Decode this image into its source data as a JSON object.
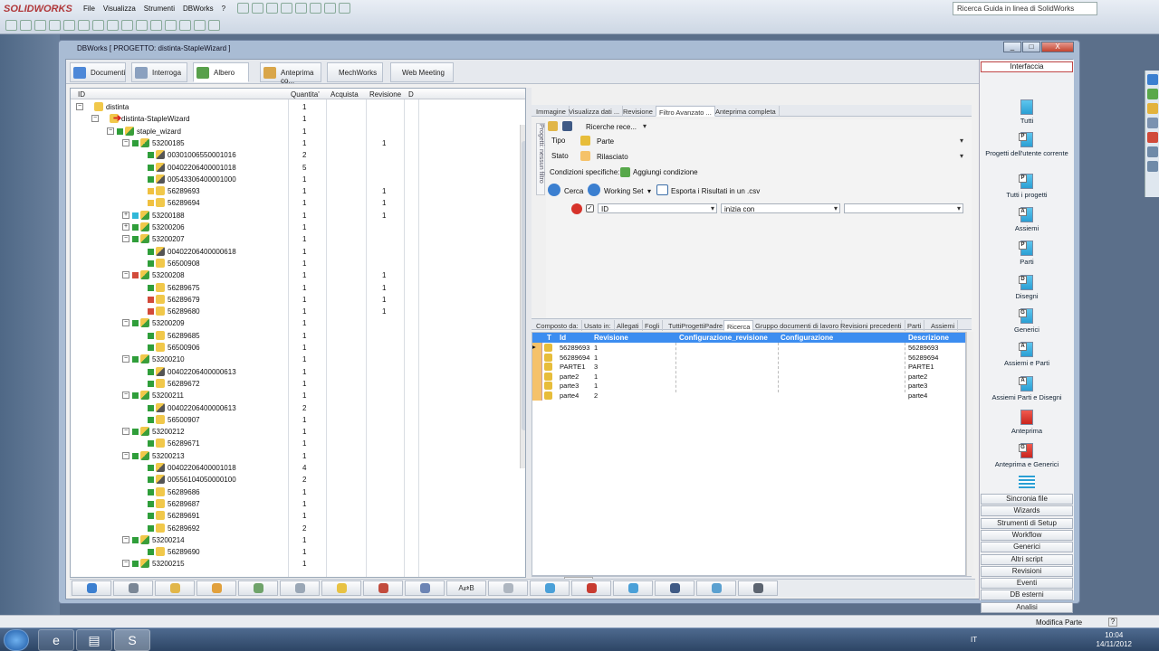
{
  "solidworks": {
    "logo": "SOLIDWORKS",
    "menu": [
      "File",
      "Visualizza",
      "Strumenti",
      "DBWorks",
      "?"
    ],
    "help_search": "Ricerca Guida in linea di SolidWorks"
  },
  "window": {
    "title": "DBWorks [ PROGETTO: distinta-StapleWizard ]",
    "minimize": "_",
    "maximize": "□",
    "close": "X"
  },
  "top_tabs": [
    "Documenti",
    "Interroga",
    "Albero",
    "Anteprima co...",
    "MechWorks",
    "Web Meeting"
  ],
  "tree": {
    "headers": {
      "id": "ID",
      "qty": "Quantita'",
      "buy": "Acquista",
      "rev": "Revisione",
      "d": "D"
    },
    "rows": [
      {
        "level": 0,
        "label": "distinta",
        "qty": "1",
        "rev": "",
        "icon": "assembly",
        "sq": "",
        "exp": "-"
      },
      {
        "level": 1,
        "label": "distinta-StapleWizard",
        "qty": "1",
        "rev": "",
        "icon": "assembly",
        "sq": "",
        "exp": "-"
      },
      {
        "level": 2,
        "label": "staple_wizard",
        "qty": "1",
        "rev": "",
        "icon": "assembly-green",
        "sq": "green",
        "exp": "-"
      },
      {
        "level": 3,
        "label": "53200185",
        "qty": "1",
        "rev": "1",
        "icon": "assembly-green",
        "sq": "green",
        "exp": "-"
      },
      {
        "level": 4,
        "label": "00301006550001016",
        "qty": "2",
        "rev": "",
        "icon": "part-tool",
        "sq": "green",
        "exp": ""
      },
      {
        "level": 4,
        "label": "00402206400001018",
        "qty": "5",
        "rev": "",
        "icon": "part-tool",
        "sq": "green",
        "exp": ""
      },
      {
        "level": 4,
        "label": "00543306400001000",
        "qty": "1",
        "rev": "",
        "icon": "part-tool",
        "sq": "green",
        "exp": ""
      },
      {
        "level": 4,
        "label": "56289693",
        "qty": "1",
        "rev": "1",
        "icon": "part",
        "sq": "yellow",
        "exp": ""
      },
      {
        "level": 4,
        "label": "56289694",
        "qty": "1",
        "rev": "1",
        "icon": "part",
        "sq": "yellow",
        "exp": ""
      },
      {
        "level": 3,
        "label": "53200188",
        "qty": "1",
        "rev": "1",
        "icon": "assembly-green",
        "sq": "cyan",
        "exp": "+"
      },
      {
        "level": 3,
        "label": "53200206",
        "qty": "1",
        "rev": "",
        "icon": "assembly-green",
        "sq": "green",
        "exp": "+"
      },
      {
        "level": 3,
        "label": "53200207",
        "qty": "1",
        "rev": "",
        "icon": "assembly-green",
        "sq": "green",
        "exp": "-"
      },
      {
        "level": 4,
        "label": "00402206400000618",
        "qty": "1",
        "rev": "",
        "icon": "part-tool",
        "sq": "green",
        "exp": ""
      },
      {
        "level": 4,
        "label": "56500908",
        "qty": "1",
        "rev": "",
        "icon": "part",
        "sq": "green",
        "exp": ""
      },
      {
        "level": 3,
        "label": "53200208",
        "qty": "1",
        "rev": "1",
        "icon": "assembly-green",
        "sq": "red",
        "exp": "-"
      },
      {
        "level": 4,
        "label": "56289675",
        "qty": "1",
        "rev": "1",
        "icon": "part",
        "sq": "green",
        "exp": ""
      },
      {
        "level": 4,
        "label": "56289679",
        "qty": "1",
        "rev": "1",
        "icon": "part",
        "sq": "red",
        "exp": ""
      },
      {
        "level": 4,
        "label": "56289680",
        "qty": "1",
        "rev": "1",
        "icon": "part",
        "sq": "red",
        "exp": ""
      },
      {
        "level": 3,
        "label": "53200209",
        "qty": "1",
        "rev": "",
        "icon": "assembly-green",
        "sq": "green",
        "exp": "-"
      },
      {
        "level": 4,
        "label": "56289685",
        "qty": "1",
        "rev": "",
        "icon": "part",
        "sq": "green",
        "exp": ""
      },
      {
        "level": 4,
        "label": "56500906",
        "qty": "1",
        "rev": "",
        "icon": "part",
        "sq": "green",
        "exp": ""
      },
      {
        "level": 3,
        "label": "53200210",
        "qty": "1",
        "rev": "",
        "icon": "assembly-green",
        "sq": "green",
        "exp": "-"
      },
      {
        "level": 4,
        "label": "00402206400000613",
        "qty": "1",
        "rev": "",
        "icon": "part-tool",
        "sq": "green",
        "exp": ""
      },
      {
        "level": 4,
        "label": "56289672",
        "qty": "1",
        "rev": "",
        "icon": "part",
        "sq": "green",
        "exp": ""
      },
      {
        "level": 3,
        "label": "53200211",
        "qty": "1",
        "rev": "",
        "icon": "assembly-green",
        "sq": "green",
        "exp": "-"
      },
      {
        "level": 4,
        "label": "00402206400000613",
        "qty": "2",
        "rev": "",
        "icon": "part-tool",
        "sq": "green",
        "exp": ""
      },
      {
        "level": 4,
        "label": "56500907",
        "qty": "1",
        "rev": "",
        "icon": "part",
        "sq": "green",
        "exp": ""
      },
      {
        "level": 3,
        "label": "53200212",
        "qty": "1",
        "rev": "",
        "icon": "assembly-green",
        "sq": "green",
        "exp": "-"
      },
      {
        "level": 4,
        "label": "56289671",
        "qty": "1",
        "rev": "",
        "icon": "part",
        "sq": "green",
        "exp": ""
      },
      {
        "level": 3,
        "label": "53200213",
        "qty": "1",
        "rev": "",
        "icon": "assembly-green",
        "sq": "green",
        "exp": "-"
      },
      {
        "level": 4,
        "label": "00402206400001018",
        "qty": "4",
        "rev": "",
        "icon": "part-tool",
        "sq": "green",
        "exp": ""
      },
      {
        "level": 4,
        "label": "00556104050000100",
        "qty": "2",
        "rev": "",
        "icon": "part-tool",
        "sq": "green",
        "exp": ""
      },
      {
        "level": 4,
        "label": "56289686",
        "qty": "1",
        "rev": "",
        "icon": "part",
        "sq": "green",
        "exp": ""
      },
      {
        "level": 4,
        "label": "56289687",
        "qty": "1",
        "rev": "",
        "icon": "part",
        "sq": "green",
        "exp": ""
      },
      {
        "level": 4,
        "label": "56289691",
        "qty": "1",
        "rev": "",
        "icon": "part",
        "sq": "green",
        "exp": ""
      },
      {
        "level": 4,
        "label": "56289692",
        "qty": "2",
        "rev": "",
        "icon": "part",
        "sq": "green",
        "exp": ""
      },
      {
        "level": 3,
        "label": "53200214",
        "qty": "1",
        "rev": "",
        "icon": "assembly-green",
        "sq": "green",
        "exp": "-"
      },
      {
        "level": 4,
        "label": "56289690",
        "qty": "1",
        "rev": "",
        "icon": "part",
        "sq": "green",
        "exp": ""
      },
      {
        "level": 3,
        "label": "53200215",
        "qty": "1",
        "rev": "",
        "icon": "assembly-green",
        "sq": "green",
        "exp": "-"
      }
    ]
  },
  "right_tabs": [
    "Immagine",
    "Visualizza dati ...",
    "Revisione",
    "Filtro Avanzato ...",
    "Anteprima completa"
  ],
  "side_label": "Progetti: nessun filtro",
  "filter": {
    "saved_searches": "Ricerche rece...",
    "tipo_label": "Tipo",
    "tipo_value": "Parte",
    "stato_label": "Stato",
    "stato_value": "Rilasciato",
    "conditions_label": "Condizioni specifiche:",
    "add_condition": "Aggiungi condizione",
    "search": "Cerca",
    "working_set": "Working Set",
    "export": "Esporta i Risultati in un .csv",
    "cond_field": "ID",
    "cond_op": "inizia con",
    "cond_value": ""
  },
  "result_tabs": [
    "Composto da:",
    "Usato in:",
    "Allegati",
    "Fogli",
    "TuttiProgettiPadre",
    "Ricerca",
    "Gruppo documenti di lavoro",
    "Revisioni precedenti",
    "Parti",
    "Assiemi"
  ],
  "grid": {
    "headers": [
      "T",
      "Id",
      "Revisione",
      "Configurazione_revisione",
      "Configurazione",
      "Descrizione"
    ],
    "rows": [
      {
        "id": "56289693",
        "rev": "1",
        "desc": "56289693"
      },
      {
        "id": "56289694",
        "rev": "1",
        "desc": "56289694"
      },
      {
        "id": "PARTE1",
        "rev": "3",
        "desc": "PARTE1"
      },
      {
        "id": "parte2",
        "rev": "1",
        "desc": "parte2"
      },
      {
        "id": "parte3",
        "rev": "1",
        "desc": "parte3"
      },
      {
        "id": "parte4",
        "rev": "2",
        "desc": "parte4"
      }
    ]
  },
  "nav": {
    "page_symbol": "#",
    "page": "1"
  },
  "side_panel": {
    "header": "Interfaccia",
    "items": [
      {
        "label": "Tutti",
        "badge": "",
        "red": false
      },
      {
        "label": "Progetti dell'utente corrente",
        "badge": "P",
        "red": false
      },
      {
        "label": "Tutti i progetti",
        "badge": "P",
        "red": false
      },
      {
        "label": "Assiemi",
        "badge": "A",
        "red": false
      },
      {
        "label": "Parti",
        "badge": "P",
        "red": false
      },
      {
        "label": "Disegni",
        "badge": "D",
        "red": false
      },
      {
        "label": "Generici",
        "badge": "G",
        "red": false
      },
      {
        "label": "Assiemi e Parti",
        "badge": "A",
        "red": false
      },
      {
        "label": "Assiemi Parti e Disegni",
        "badge": "A",
        "red": false
      },
      {
        "label": "Anteprima",
        "badge": "",
        "red": true
      },
      {
        "label": "Anteprima e Generici",
        "badge": "G",
        "red": true
      }
    ],
    "buttons": [
      "Sincronia file",
      "Wizards",
      "Strumenti di Setup",
      "Workflow",
      "Generici",
      "Altri script",
      "Revisioni",
      "Eventi",
      "DB esterni",
      "Analisi"
    ]
  },
  "bottom_toolbar": {
    "text_button": "A⇄B"
  },
  "status": {
    "text": "Modifica Parte",
    "help": "?"
  },
  "taskbar": {
    "lang": "IT",
    "time": "10:04",
    "date": "14/11/2012"
  }
}
